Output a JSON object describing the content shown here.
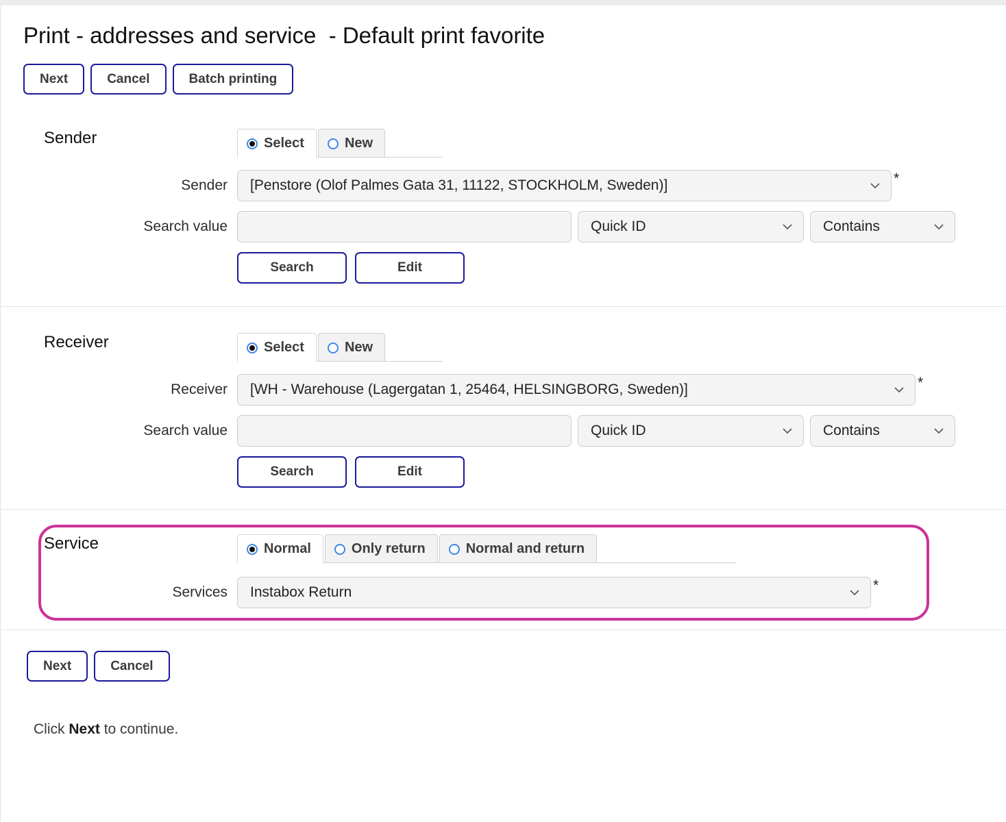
{
  "header": {
    "title": "Print - addresses and service  - Default print favorite",
    "toolbar": [
      {
        "label": "Next",
        "name": "next-button"
      },
      {
        "label": "Cancel",
        "name": "cancel-button"
      },
      {
        "label": "Batch printing",
        "name": "batch-printing-button"
      }
    ]
  },
  "sender": {
    "section_label": "Sender",
    "tabs": [
      {
        "label": "Select",
        "selected": true
      },
      {
        "label": "New",
        "selected": false
      }
    ],
    "address_label": "Sender",
    "address_value": "[Penstore (Olof Palmes Gata 31, 11122, STOCKHOLM, Sweden)]",
    "required_mark": "*",
    "search_label": "Search value",
    "search_value": "",
    "search_placeholder": "",
    "field_dropdown": "Quick ID",
    "match_dropdown": "Contains",
    "search_button": "Search",
    "edit_button": "Edit"
  },
  "receiver": {
    "section_label": "Receiver",
    "tabs": [
      {
        "label": "Select",
        "selected": true
      },
      {
        "label": "New",
        "selected": false
      }
    ],
    "address_label": "Receiver",
    "address_value": "[WH - Warehouse (Lagergatan 1, 25464, HELSINGBORG, Sweden)]",
    "required_mark": "*",
    "search_label": "Search value",
    "search_value": "",
    "search_placeholder": "",
    "field_dropdown": "Quick ID",
    "match_dropdown": "Contains",
    "search_button": "Search",
    "edit_button": "Edit"
  },
  "service": {
    "section_label": "Service",
    "tabs": [
      {
        "label": "Normal",
        "selected": true
      },
      {
        "label": "Only return",
        "selected": false
      },
      {
        "label": "Normal and return",
        "selected": false
      }
    ],
    "services_label": "Services",
    "services_value": "Instabox Return",
    "required_mark": "*",
    "highlight_color": "#cc3399"
  },
  "footer": {
    "buttons": [
      {
        "label": "Next",
        "name": "next-button"
      },
      {
        "label": "Cancel",
        "name": "cancel-button"
      }
    ],
    "note_prefix": "Click ",
    "note_bold": "Next",
    "note_suffix": " to continue."
  }
}
